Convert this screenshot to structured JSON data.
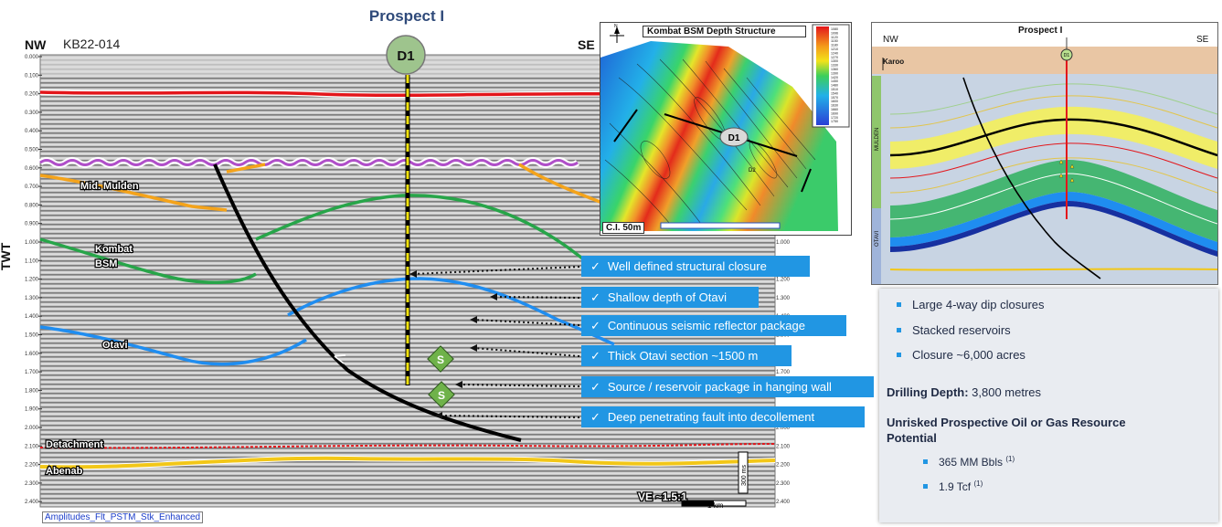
{
  "section": {
    "title": "Prospect I",
    "left_label": "NW",
    "right_label": "SE",
    "line_name": "KB22-014",
    "axis_label": "TWT",
    "well": "D1",
    "ve": "VE ~1.5:1",
    "scale_km": "1 km",
    "scale_ms": "300 ms",
    "footer": "Amplitudes_Flt_PSTM_Stk_Enhanced",
    "left_ticks": [
      "0.000",
      "0.100",
      "0.200",
      "0.300",
      "0.400",
      "0.500",
      "0.600",
      "0.700",
      "0.800",
      "0.900",
      "1.000",
      "1.100",
      "1.200",
      "1.300",
      "1.400",
      "1.500",
      "1.600",
      "1.700",
      "1.800",
      "1.900",
      "2.000",
      "2.100",
      "2.200",
      "2.300",
      "2.400"
    ],
    "right_ticks": [
      "1.000",
      "1.100",
      "1.200",
      "1.300",
      "1.400",
      "1.500",
      "1.600",
      "1.700",
      "1.800",
      "1.900",
      "2.000",
      "2.100",
      "2.200",
      "2.300",
      "2.400"
    ],
    "horizons": [
      "Mid. Mulden",
      "Kombat",
      "BSM",
      "Otavi",
      "Detachment",
      "Abenab"
    ],
    "source_marker": "S",
    "colors": {
      "red": "#e3161b",
      "purple": "#b04fc9",
      "orange": "#f4a31a",
      "green": "#27a549",
      "blue": "#1f8df0",
      "yellow": "#f2c718",
      "fault": "#000000",
      "callout": "#2196e3"
    }
  },
  "callouts": [
    "Well defined structural closure",
    "Shallow depth of Otavi",
    "Continuous seismic reflector package",
    "Thick Otavi section ~1500 m",
    "Source / reservoir package in hanging wall",
    "Deep penetrating fault into decollement"
  ],
  "callout_check": "✓",
  "map": {
    "title": "Kombat BSM Depth Structure",
    "contour_interval": "C.I. 50m",
    "well_d1": "D1",
    "well_d2": "D2",
    "north": "N",
    "legend_values": [
      "1080",
      "1096",
      "1120",
      "1150",
      "1180",
      "1210",
      "1240",
      "1270",
      "1300",
      "1330",
      "1360",
      "1390",
      "1420",
      "1450",
      "1480",
      "1510",
      "1540",
      "1570",
      "1600",
      "1630",
      "1660",
      "1690",
      "1720",
      "1750"
    ]
  },
  "cross_section": {
    "title": "Prospect I",
    "left": "NW",
    "right": "SE",
    "karoo": "Karoo",
    "mulden": "MULDEN",
    "otavi": "OTAVI",
    "well": "D1"
  },
  "summary": {
    "bullets": [
      "Large 4-way dip closures",
      "Stacked reservoirs",
      "Closure ~6,000 acres"
    ],
    "drilling_label": "Drilling Depth:",
    "drilling_value": " 3,800 metres",
    "resource_heading": "Unrisked Prospective Oil or Gas Resource Potential",
    "resources": [
      {
        "value": "365 MM Bbls",
        "note": "(1)"
      },
      {
        "value": "1.9 Tcf",
        "note": "(1)"
      }
    ]
  }
}
